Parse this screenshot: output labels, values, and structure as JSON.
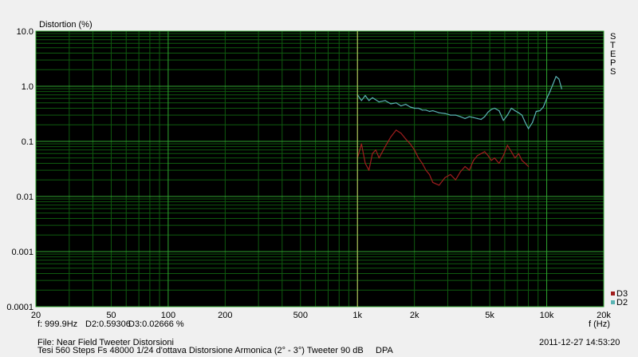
{
  "header": {
    "y_title": "Distortion (%)",
    "side_label": [
      "S",
      "T",
      "E",
      "P",
      "S"
    ]
  },
  "axes": {
    "x_unit_label": "f (Hz)"
  },
  "cursor_readout": {
    "frequency": "f: 999.9Hz",
    "d2": "D2:0.59306",
    "d3": "D3:0.02666 %"
  },
  "footer": {
    "file_line": "File: Near Field Tweeter Distorsioni",
    "desc_line": "Tesi 560 Steps Fs 48000 1/24 d'ottava Distorsione Armonica (2° - 3°) Tweeter 90 dB     DPA",
    "timestamp": "2011-12-27 14:53:20"
  },
  "colors": {
    "background": "#000000",
    "grid_major": "#2fa52f",
    "grid_minor": "#0f5a0f",
    "cursor": "#c8c864",
    "d2": "#5ab4b4",
    "d3": "#a01e1e",
    "window": "#f0f0f0"
  },
  "chart_data": {
    "type": "line",
    "x_scale": "log",
    "y_scale": "log",
    "xlim": [
      20,
      20000
    ],
    "ylim": [
      0.0001,
      10
    ],
    "ylabel": "Distortion (%)",
    "xlabel": "f (Hz)",
    "x_ticks": [
      {
        "value": 20,
        "label": "20"
      },
      {
        "value": 50,
        "label": "50"
      },
      {
        "value": 100,
        "label": "100"
      },
      {
        "value": 200,
        "label": "200"
      },
      {
        "value": 500,
        "label": "500"
      },
      {
        "value": 1000,
        "label": "1k"
      },
      {
        "value": 2000,
        "label": "2k"
      },
      {
        "value": 5000,
        "label": "5k"
      },
      {
        "value": 10000,
        "label": "10k"
      },
      {
        "value": 20000,
        "label": "20k"
      }
    ],
    "y_ticks": [
      {
        "value": 10,
        "label": "10.0"
      },
      {
        "value": 1,
        "label": "1.0"
      },
      {
        "value": 0.1,
        "label": "0.1"
      },
      {
        "value": 0.01,
        "label": "0.01"
      },
      {
        "value": 0.001,
        "label": "0.001"
      },
      {
        "value": 0.0001,
        "label": "0.0001"
      }
    ],
    "cursor_x": 1000,
    "grid": true,
    "legend_position": "bottom-right",
    "series": [
      {
        "name": "D2",
        "color": "#5ab4b4",
        "x": [
          1000,
          1050,
          1100,
          1150,
          1200,
          1300,
          1400,
          1500,
          1600,
          1700,
          1800,
          1900,
          2000,
          2100,
          2200,
          2300,
          2400,
          2500,
          2700,
          2900,
          3100,
          3300,
          3500,
          3700,
          3900,
          4100,
          4300,
          4500,
          4700,
          4900,
          5100,
          5300,
          5600,
          5900,
          6200,
          6500,
          6800,
          7100,
          7400,
          7700,
          8000,
          8400,
          8800,
          9200,
          9600,
          10000,
          10400,
          10800,
          11200,
          11600,
          12000
        ],
        "values": [
          0.7,
          0.55,
          0.68,
          0.55,
          0.62,
          0.52,
          0.55,
          0.48,
          0.5,
          0.44,
          0.47,
          0.42,
          0.4,
          0.4,
          0.37,
          0.37,
          0.35,
          0.36,
          0.33,
          0.32,
          0.3,
          0.3,
          0.28,
          0.26,
          0.28,
          0.27,
          0.26,
          0.25,
          0.28,
          0.34,
          0.38,
          0.4,
          0.36,
          0.24,
          0.3,
          0.4,
          0.36,
          0.33,
          0.3,
          0.22,
          0.17,
          0.22,
          0.35,
          0.36,
          0.42,
          0.6,
          0.8,
          1.1,
          1.5,
          1.35,
          0.9
        ]
      },
      {
        "name": "D3",
        "color": "#a01e1e",
        "x": [
          1000,
          1050,
          1100,
          1150,
          1200,
          1250,
          1300,
          1400,
          1500,
          1600,
          1700,
          1800,
          1900,
          2000,
          2100,
          2200,
          2300,
          2400,
          2500,
          2700,
          2900,
          3100,
          3300,
          3500,
          3700,
          3900,
          4100,
          4300,
          4500,
          4700,
          4900,
          5100,
          5300,
          5600,
          5900,
          6200,
          6500,
          6800,
          7100,
          7400,
          7700,
          8000
        ],
        "values": [
          0.05,
          0.09,
          0.04,
          0.03,
          0.06,
          0.07,
          0.05,
          0.08,
          0.12,
          0.16,
          0.14,
          0.11,
          0.09,
          0.07,
          0.05,
          0.04,
          0.03,
          0.025,
          0.018,
          0.016,
          0.022,
          0.025,
          0.02,
          0.028,
          0.035,
          0.03,
          0.045,
          0.055,
          0.06,
          0.065,
          0.055,
          0.045,
          0.05,
          0.04,
          0.055,
          0.085,
          0.065,
          0.05,
          0.06,
          0.045,
          0.04,
          0.035
        ]
      }
    ]
  }
}
